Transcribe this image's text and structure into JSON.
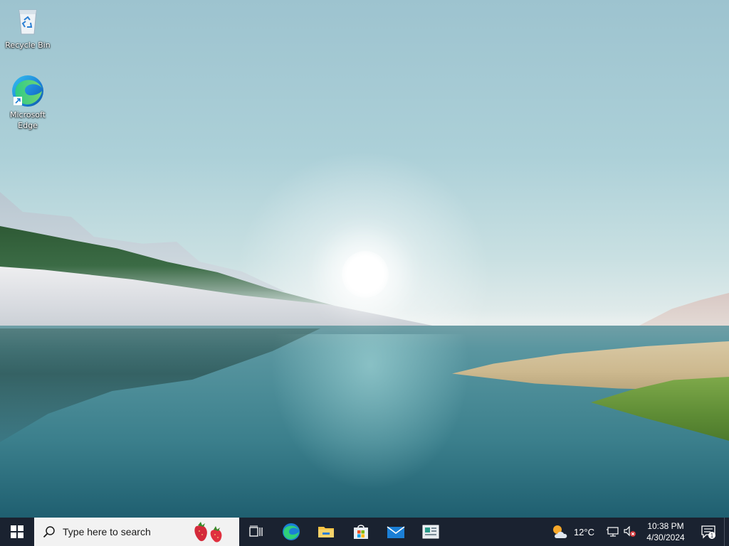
{
  "desktop": {
    "icons": [
      {
        "label": "Recycle Bin",
        "icon": "recycle-bin-icon"
      },
      {
        "label": "Microsoft\nEdge",
        "icon": "edge-icon"
      }
    ]
  },
  "taskbar": {
    "search": {
      "placeholder": "Type here to search",
      "icon": "search-icon",
      "highlight": "strawberries"
    },
    "pinned_apps": [
      {
        "name": "Task View",
        "icon": "task-view-icon"
      },
      {
        "name": "Microsoft Edge",
        "icon": "edge-icon"
      },
      {
        "name": "File Explorer",
        "icon": "folder-icon"
      },
      {
        "name": "Microsoft Store",
        "icon": "store-icon"
      },
      {
        "name": "Mail",
        "icon": "mail-icon"
      },
      {
        "name": "News",
        "icon": "news-icon"
      }
    ],
    "weather": {
      "temp": "12°C",
      "icon": "partly-cloudy-icon"
    },
    "tray": {
      "network_icon": "network-icon",
      "volume_icon": "volume-muted-icon"
    },
    "clock": {
      "time": "10:38 PM",
      "date": "4/30/2024"
    },
    "notifications": {
      "count": "1",
      "icon": "action-center-icon"
    }
  },
  "colors": {
    "taskbar_bg": "#1a2230",
    "search_bg": "#f2f2f2",
    "accent_blue": "#0078d4"
  }
}
